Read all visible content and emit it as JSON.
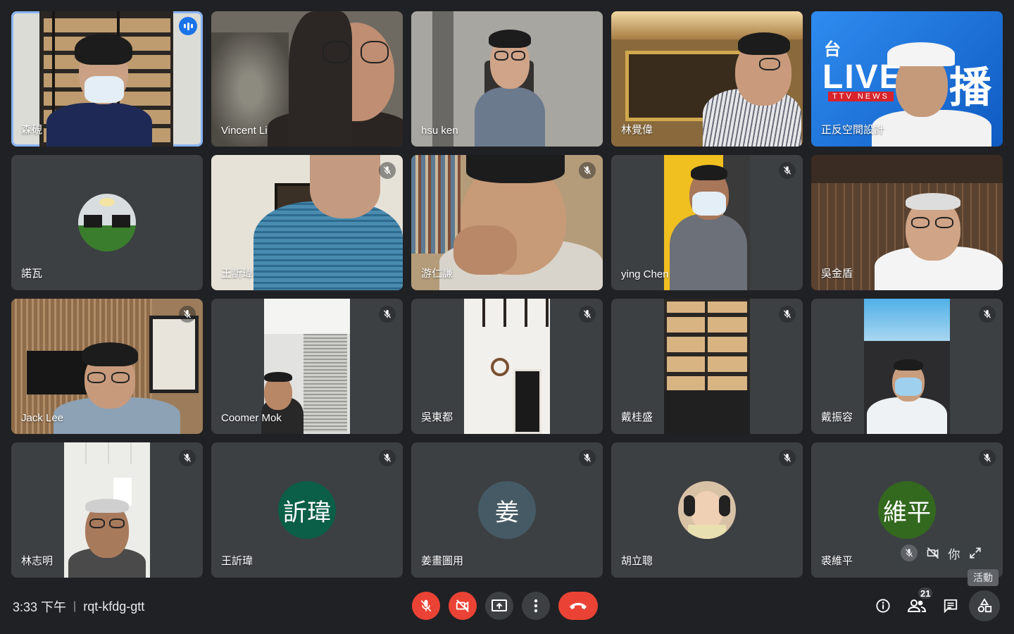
{
  "participants": [
    {
      "name": "森硯",
      "muted": false,
      "speaking": true
    },
    {
      "name": "Vincent Li",
      "muted": false
    },
    {
      "name": "hsu ken",
      "muted": false
    },
    {
      "name": "林覺偉",
      "muted": false
    },
    {
      "name": "正反空間設計",
      "muted": false,
      "overlay_text": "LIVE",
      "overlay_text2": "播",
      "overlay_text3": "TTV NEWS",
      "overlay_text4": "台"
    },
    {
      "name": "諾瓦",
      "muted": false
    },
    {
      "name": "王訢瑋",
      "muted": true
    },
    {
      "name": "游仁謙",
      "muted": true
    },
    {
      "name": "ying Chen",
      "muted": true
    },
    {
      "name": "吳金盾",
      "muted": false
    },
    {
      "name": "Jack Lee",
      "muted": true
    },
    {
      "name": "Coomer Mok",
      "muted": true
    },
    {
      "name": "吳東都",
      "muted": true
    },
    {
      "name": "戴桂盛",
      "muted": true
    },
    {
      "name": "戴振容",
      "muted": true
    },
    {
      "name": "林志明",
      "muted": true
    },
    {
      "name": "王訢瑋",
      "muted": true,
      "avatar_text": "訢瑋",
      "avatar_color": "#0b5e48"
    },
    {
      "name": "姜畫圖用",
      "muted": true,
      "avatar_text": "姜",
      "avatar_color": "#455a64"
    },
    {
      "name": "胡立聰",
      "muted": true
    },
    {
      "name": "裘維平",
      "muted": true,
      "avatar_text": "維平",
      "avatar_color": "#33691e"
    }
  ],
  "self_pill": {
    "label": "你"
  },
  "bottom_bar": {
    "time": "3:33 下午",
    "separator": "|",
    "meeting_code": "rqt-kfdg-gtt",
    "participant_count": "21",
    "activities_tooltip": "活動"
  },
  "colors": {
    "background": "#202124",
    "tile": "#3c4043",
    "red_button": "#ea4335",
    "accent_blue": "#1a73e8",
    "active_outline": "#8ab4f8"
  }
}
